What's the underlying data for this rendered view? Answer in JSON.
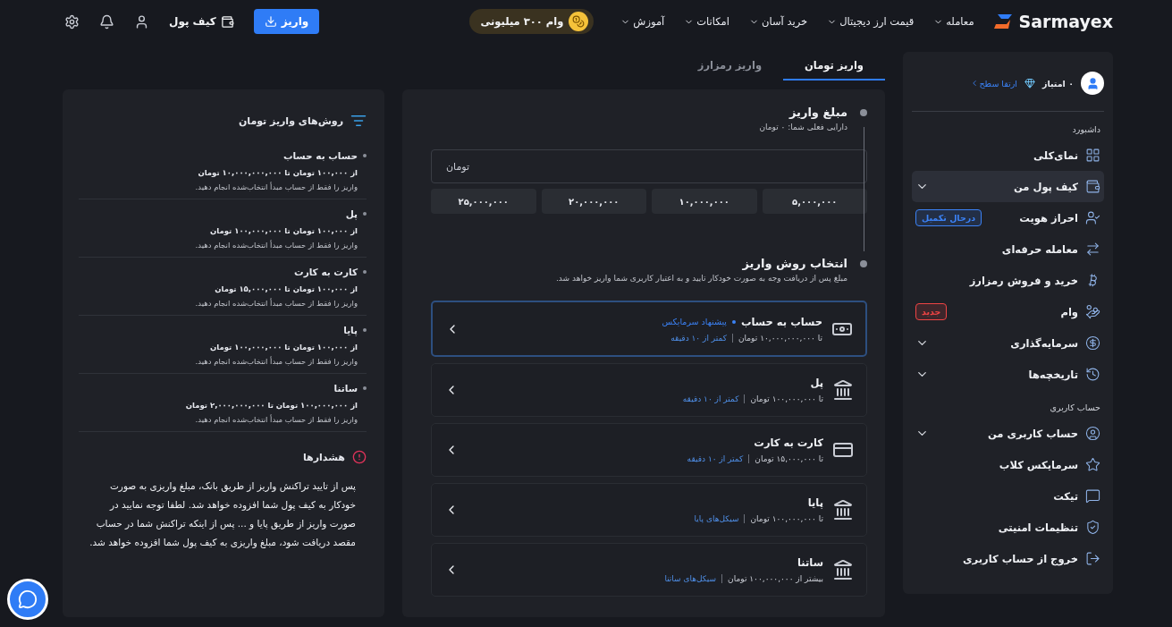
{
  "header": {
    "logo": "Sarmayex",
    "nav": [
      {
        "label": "معامله"
      },
      {
        "label": "قیمت ارز دیجیتال"
      },
      {
        "label": "خرید آسان"
      },
      {
        "label": "امکانات"
      },
      {
        "label": "آموزش"
      }
    ],
    "promo": "وام ۳۰۰ میلیونی",
    "deposit_button": "واریز",
    "wallet_link": "کیف پول"
  },
  "sidebar": {
    "points": "۰ امتیاز",
    "upgrade_link": "ارتقا سطح",
    "sections": [
      {
        "title": "داشبورد",
        "items": [
          {
            "label": "نمای‌کلی",
            "selected": false,
            "expandable": false
          },
          {
            "label": "کیف پول من",
            "selected": true,
            "expandable": true
          },
          {
            "label": "احراز هویت",
            "selected": false,
            "expandable": false,
            "badge": {
              "text": "درحال تکمیل",
              "color": "#3b82f6"
            }
          },
          {
            "label": "معامله حرفه‌ای",
            "selected": false,
            "expandable": false
          },
          {
            "label": "خرید و فروش رمزارز",
            "selected": false,
            "expandable": false
          },
          {
            "label": "وام",
            "selected": false,
            "expandable": false,
            "badge": {
              "text": "جدید",
              "color": "#ef4444"
            }
          },
          {
            "label": "سرمایه‌گذاری",
            "selected": false,
            "expandable": true
          },
          {
            "label": "تاریخچه‌ها",
            "selected": false,
            "expandable": true
          }
        ]
      },
      {
        "title": "حساب کاربری",
        "items": [
          {
            "label": "حساب کاربری من",
            "selected": false,
            "expandable": true
          },
          {
            "label": "سرمایکس کلاب",
            "selected": false,
            "expandable": false
          },
          {
            "label": "تیکت",
            "selected": false,
            "expandable": false
          },
          {
            "label": "تنظیمات امنیتی",
            "selected": false,
            "expandable": false
          },
          {
            "label": "خروج از حساب کاربری",
            "selected": false,
            "expandable": false
          }
        ]
      }
    ]
  },
  "tabs": [
    {
      "label": "واریز تومان",
      "selected": true
    },
    {
      "label": "واریز رمزارز",
      "selected": false
    }
  ],
  "amount_step": {
    "title": "مبلغ واریز",
    "balance": "دارایی فعلی شما: ۰ تومان",
    "unit": "تومان",
    "presets": [
      "۵,۰۰۰,۰۰۰",
      "۱۰,۰۰۰,۰۰۰",
      "۲۰,۰۰۰,۰۰۰",
      "۲۵,۰۰۰,۰۰۰"
    ]
  },
  "method_step": {
    "title": "انتخاب روش واریز",
    "description": "مبلغ پس از دریافت وجه به صورت خودکار تایید و به اعتبار کاربری شما واریز خواهد شد.",
    "methods": [
      {
        "name": "حساب به حساب",
        "tag": "پیشنهاد سرمایکس",
        "limit": "تا ۱۰,۰۰۰,۰۰۰,۰۰۰ تومان",
        "time": "کمتر از ۱۰ دقیقه",
        "selected": true
      },
      {
        "name": "پل",
        "limit": "تا ۱۰۰,۰۰۰,۰۰۰ تومان",
        "time": "کمتر از ۱۰ دقیقه",
        "selected": false
      },
      {
        "name": "کارت به کارت",
        "limit": "تا ۱۵,۰۰۰,۰۰۰ تومان",
        "time": "کمتر از ۱۰ دقیقه",
        "selected": false
      },
      {
        "name": "پایا",
        "limit": "تا ۱۰۰,۰۰۰,۰۰۰ تومان",
        "time": "سیکل‌های پایا",
        "selected": false
      },
      {
        "name": "ساتنا",
        "limit": "بیشتر از ۱۰۰,۰۰۰,۰۰۰ تومان",
        "time": "سیکل‌های ساتنا",
        "selected": false
      }
    ]
  },
  "info_panel": {
    "title": "روش‌های واریز تومان",
    "methods": [
      {
        "name": "حساب به حساب",
        "range": "از ۱۰۰,۰۰۰ تومان تا ۱۰,۰۰۰,۰۰۰,۰۰۰ تومان",
        "note": "واریز را فقط از حساب مبدأ انتخاب‌شده انجام دهید."
      },
      {
        "name": "پل",
        "range": "از ۱۰۰,۰۰۰ تومان تا ۱۰۰,۰۰۰,۰۰۰ تومان",
        "note": "واریز را فقط از حساب مبدأ انتخاب‌شده انجام دهید."
      },
      {
        "name": "کارت به کارت",
        "range": "از ۱۰۰,۰۰۰ تومان تا ۱۵,۰۰۰,۰۰۰ تومان",
        "note": "واریز را فقط از حساب مبدأ انتخاب‌شده انجام دهید."
      },
      {
        "name": "پایا",
        "range": "از ۱۰۰,۰۰۰ تومان تا ۱۰۰,۰۰۰,۰۰۰ تومان",
        "note": "واریز را فقط از حساب مبدأ انتخاب‌شده انجام دهید."
      },
      {
        "name": "ساتنا",
        "range": "از ۱۰۰,۰۰۰,۰۰۰ تومان تا ۲,۰۰۰,۰۰۰,۰۰۰ تومان",
        "note": "واریز را فقط از حساب مبدأ انتخاب‌شده انجام دهید."
      }
    ],
    "warnings_title": "هشدارها",
    "warnings_text": "پس از تایید تراکنش واریز از طریق بانک، مبلغ واریزی به صورت خودکار به کیف پول شما افزوده خواهد شد. لطفا توجه نمایید در صورت واریز از طریق پایا و ... پس از اینکه تراکنش شما در حساب مقصد دریافت شود، مبلغ واریزی به کیف پول شما افزوده خواهد شد."
  }
}
